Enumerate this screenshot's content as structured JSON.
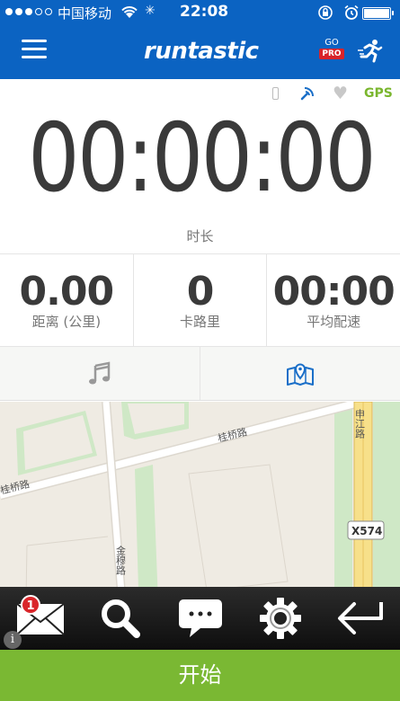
{
  "status_bar": {
    "carrier": "中国移动",
    "time": "22:08",
    "battery_level": 1.0
  },
  "app_bar": {
    "logo": "runtastic",
    "go_pro_top": "GO",
    "go_pro_bottom": "PRO",
    "menu_icon": "hamburger-menu-icon",
    "runner_icon": "runner-icon"
  },
  "indicators": {
    "gps": "GPS",
    "phone_icon": "phone-icon",
    "sensor_icon": "sensor-icon",
    "heart_icon": "heart-icon",
    "gps_color": "#7ab62e"
  },
  "timer": {
    "value": "00:00:00",
    "label": "时长"
  },
  "stats": [
    {
      "value": "0.00",
      "label": "距离 (公里)"
    },
    {
      "value": "0",
      "label": "卡路里"
    },
    {
      "value": "00:00",
      "label": "平均配速"
    }
  ],
  "tabs": [
    {
      "icon": "music-note-icon",
      "active": false
    },
    {
      "icon": "map-icon",
      "active": true
    }
  ],
  "map": {
    "road_labels": [
      "桂桥路",
      "桂桥路",
      "申江路",
      "金穆路"
    ],
    "route_sign": "X574"
  },
  "toolbar": {
    "buttons": [
      {
        "icon": "mail-icon",
        "badge": "1"
      },
      {
        "icon": "search-icon"
      },
      {
        "icon": "chat-bubble-icon"
      },
      {
        "icon": "gear-icon"
      },
      {
        "icon": "back-arrow-icon"
      }
    ],
    "info_glyph": "i"
  },
  "start_button": {
    "label": "开始"
  },
  "colors": {
    "brand_blue": "#0b63c2",
    "start_green": "#7ab833",
    "badge_red": "#d9262b"
  }
}
